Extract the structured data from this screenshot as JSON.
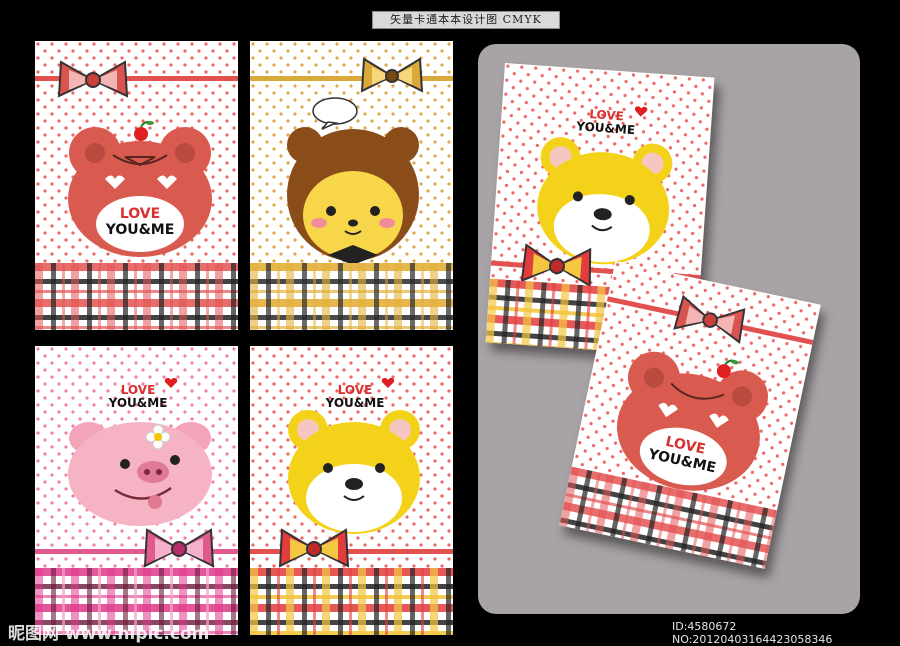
{
  "header": {
    "title": "矢量卡通本本设计图 CMYK"
  },
  "cards": [
    {
      "name": "frog-card-top-left",
      "love": "LOVE",
      "youme": "YOU&ME"
    },
    {
      "name": "bear-costume-card-top-middle"
    },
    {
      "name": "pig-card-bottom-left",
      "love": "LOVE",
      "youme": "YOU&ME"
    },
    {
      "name": "bear-card-bottom-middle",
      "love": "LOVE",
      "youme": "YOU&ME"
    },
    {
      "name": "bear-card-tilted",
      "love": "LOVE",
      "youme": "YOU&ME"
    },
    {
      "name": "frog-card-tilted",
      "love": "LOVE",
      "youme": "YOU&ME"
    }
  ],
  "watermark": {
    "site": "昵图网 www.nipic.com",
    "id": "ID:4580672 NO:20120403164423058346"
  },
  "colors": {
    "background": "#000000",
    "panel": "#a8a3a6",
    "frog": "#d95b50",
    "bear": "#f5d21a",
    "pig": "#f4a4b8",
    "ribbon_red": "#e25050",
    "ribbon_gold": "#d9a93a",
    "ribbon_pink": "#e05a90"
  }
}
